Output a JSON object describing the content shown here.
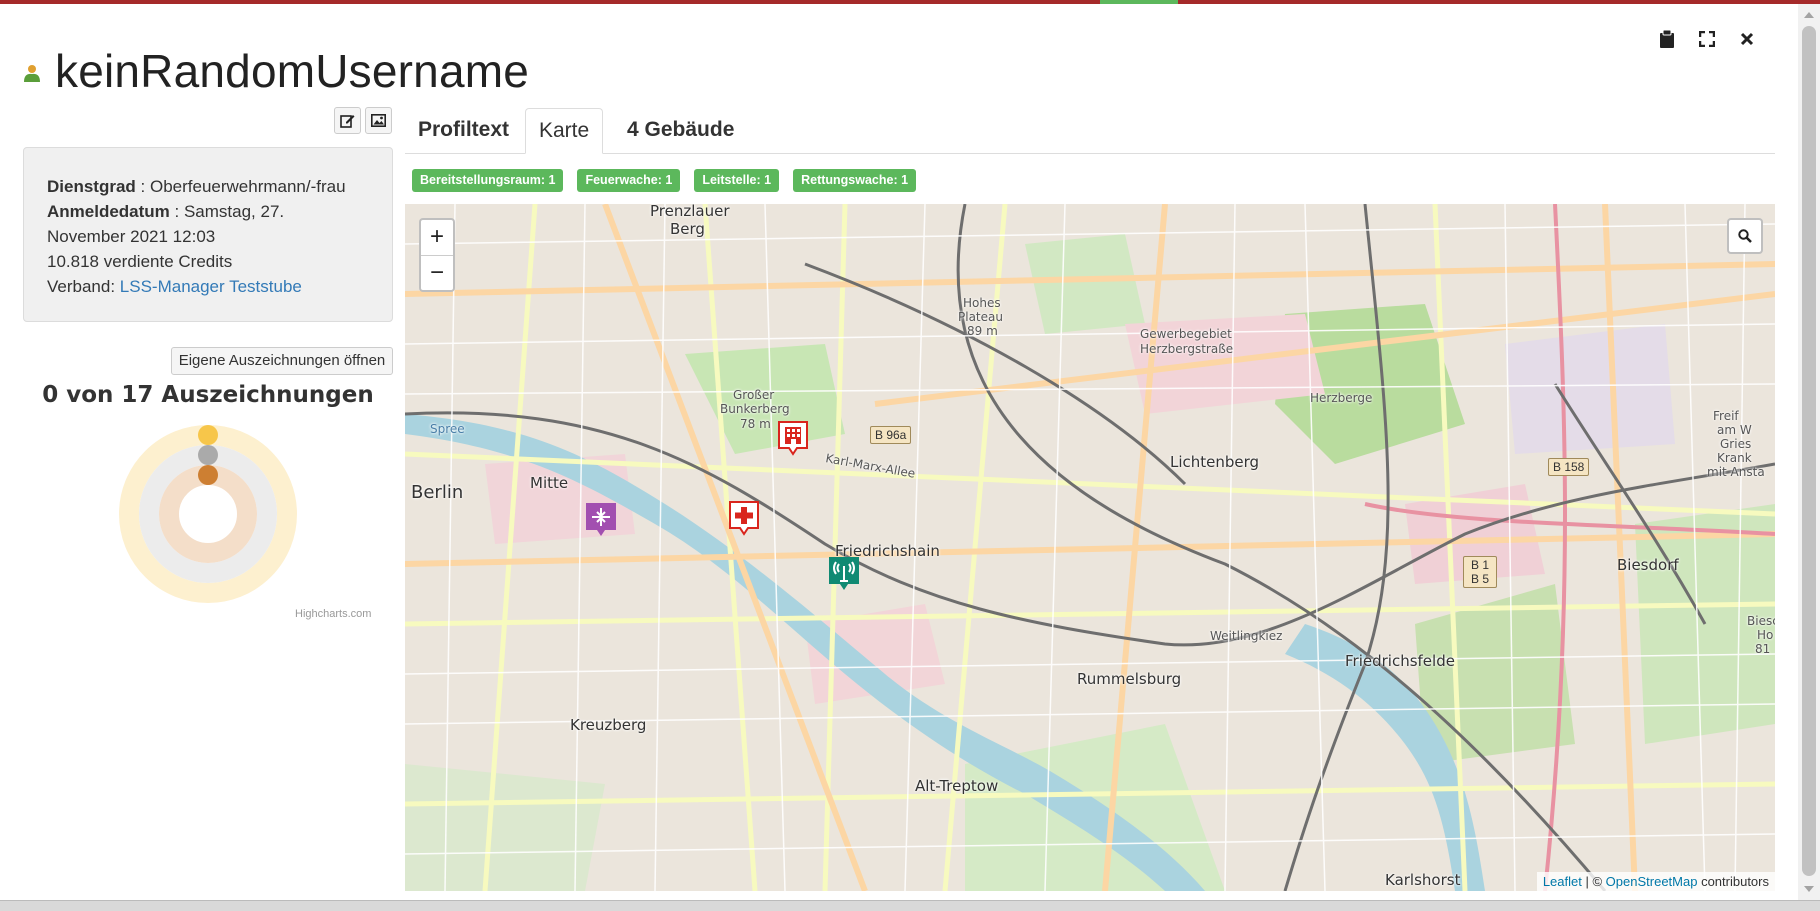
{
  "window": {
    "actions": [
      {
        "name": "clipboard-icon",
        "glyph": "📋"
      },
      {
        "name": "fullscreen-icon",
        "glyph": "⛶"
      },
      {
        "name": "close-icon",
        "glyph": "✕"
      }
    ]
  },
  "profile": {
    "username": "keinRandomUsername",
    "rank_label": "Dienstgrad",
    "rank_value": " : Oberfeuerwehrmann/-frau",
    "registered_label": "Anmeldedatum",
    "registered_value": " : Samstag, 27.",
    "registered_value_2": "November 2021 12:03",
    "credits": "10.818 verdiente Credits",
    "alliance_label": "Verband: ",
    "alliance_name": "LSS-Manager Teststube"
  },
  "awards": {
    "button_label": "Eigene Auszeichnungen öffnen",
    "title": "0 von 17 Auszeichnungen",
    "chart_credit": "Highcharts.com",
    "rings": [
      {
        "name": "gold",
        "earned": 0,
        "color": "#f7c64a"
      },
      {
        "name": "silver",
        "earned": 0,
        "color": "#aaaaaa"
      },
      {
        "name": "bronze",
        "earned": 0,
        "color": "#cd7f32"
      }
    ]
  },
  "tabs": [
    {
      "label": "Profiltext",
      "active": false
    },
    {
      "label": "Karte",
      "active": true
    },
    {
      "label": "4 Gebäude",
      "active": false
    }
  ],
  "badges": [
    "Bereitstellungsraum: 1",
    "Feuerwache: 1",
    "Leitstelle: 1",
    "Rettungswache: 1"
  ],
  "map": {
    "zoom_in": "+",
    "zoom_out": "−",
    "attribution_leaflet": "Leaflet",
    "attribution_sep": " | © ",
    "attribution_osm": "OpenStreetMap",
    "attribution_suffix": " contributors",
    "labels": {
      "prenzlauer": "Prenzlauer",
      "berg": "Berg",
      "berlin": "Berlin",
      "mitte": "Mitte",
      "friedrichshain": "Friedrichshain",
      "lichtenberg": "Lichtenberg",
      "kreuzberg": "Kreuzberg",
      "rummelsburg": "Rummelsburg",
      "alt_treptow": "Alt-Treptow",
      "friedrichsfelde": "Friedrichsfelde",
      "biesdorf": "Biesdorf",
      "karlshorst": "Karlshorst",
      "herzberge": "Herzberge",
      "weitlingkiez": "Weitlingkiez",
      "gewerbe_1": "Gewerbegebiet",
      "gewerbe_2": "Herzbergstraße",
      "hohes_1": "Hohes",
      "hohes_2": "Plateau",
      "hohes_3": "89 m",
      "bunker_1": "Großer",
      "bunker_2": "Bunkerberg",
      "bunker_3": "78 m",
      "karl_marx": "Karl-Marx-Allee",
      "spree": "Spree",
      "b96a": "B 96a",
      "b158": "B 158",
      "b1b5": "B 1 B 5",
      "freif_1": "Freif",
      "freif_2": "am W",
      "freif_3": "Gries",
      "freif_4": "Krank",
      "freif_5": "mit Ansta",
      "biesd_1": "Biesc",
      "biesd_2": "Ho",
      "biesd_3": "81"
    },
    "markers": [
      {
        "name": "feuerwache-marker",
        "type": "fire-station",
        "color": "#d9251d"
      },
      {
        "name": "rettungswache-marker",
        "type": "rescue-station",
        "color": "#d9251d"
      },
      {
        "name": "bereitstellungsraum-marker",
        "type": "staging-area",
        "color": "#a24fb0"
      },
      {
        "name": "leitstelle-marker",
        "type": "dispatch-center",
        "color": "#108a73"
      }
    ]
  }
}
